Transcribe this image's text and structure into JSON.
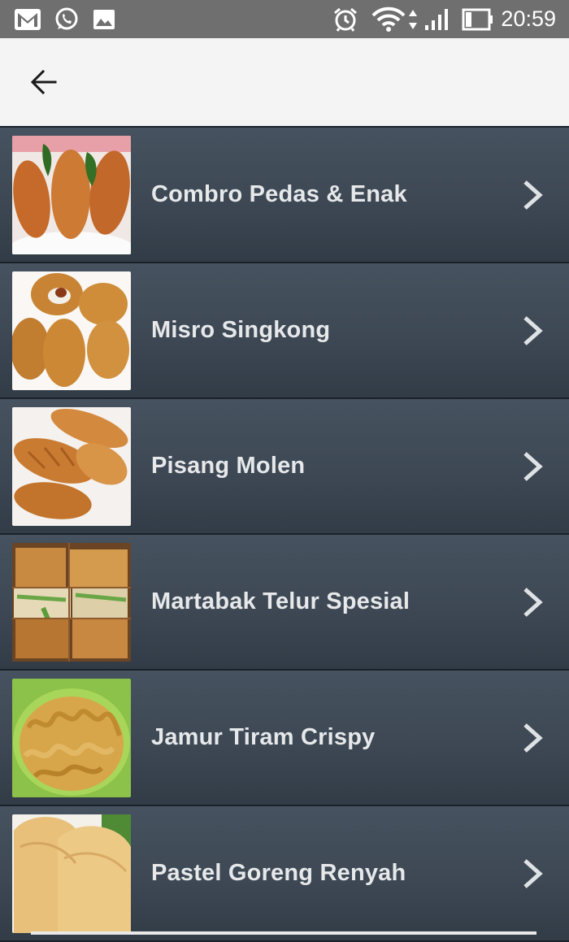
{
  "status_bar": {
    "time": "20:59",
    "icons": [
      "gmail-icon",
      "whatsapp-icon",
      "gallery-icon",
      "alarm-icon",
      "wifi-icon",
      "signal-icon",
      "battery-icon"
    ]
  },
  "app_bar": {
    "back_icon": "arrow-left-icon"
  },
  "recipes": [
    {
      "title": "Combro Pedas & Enak",
      "thumb": "combro"
    },
    {
      "title": "Misro Singkong",
      "thumb": "misro"
    },
    {
      "title": "Pisang Molen",
      "thumb": "molen"
    },
    {
      "title": "Martabak Telur Spesial",
      "thumb": "martabak"
    },
    {
      "title": "Jamur Tiram Crispy",
      "thumb": "jamur"
    },
    {
      "title": "Pastel Goreng Renyah",
      "thumb": "pastel"
    }
  ],
  "colors": {
    "status_bar": "#6f6f6f",
    "app_bar": "#f4f4f4",
    "list_bg": "#3d4854",
    "title_text": "#e6e8ea"
  }
}
